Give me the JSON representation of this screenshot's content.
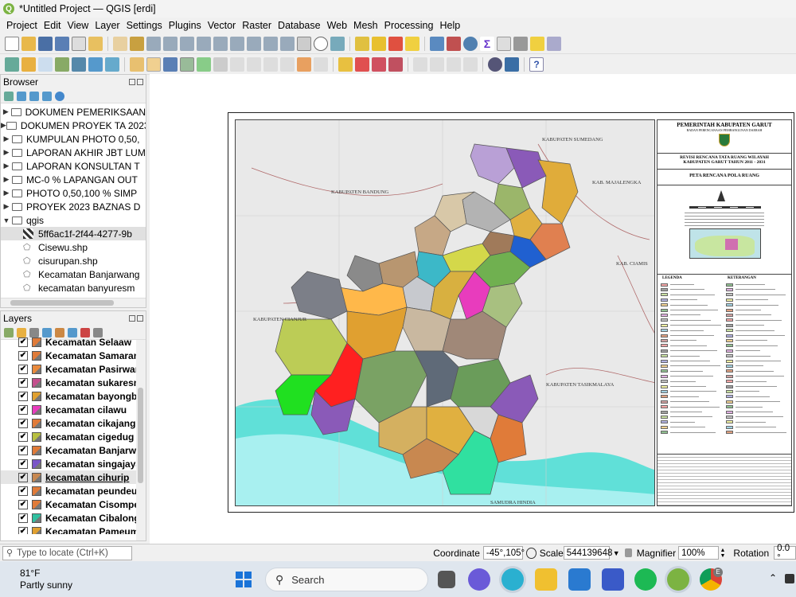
{
  "window": {
    "title": "*Untitled Project — QGIS [erdi]"
  },
  "menu": [
    "Project",
    "Edit",
    "View",
    "Layer",
    "Settings",
    "Plugins",
    "Vector",
    "Raster",
    "Database",
    "Web",
    "Mesh",
    "Processing",
    "Help"
  ],
  "browser": {
    "title": "Browser",
    "items": [
      {
        "label": "DOKUMEN PEMERIKSAAN",
        "type": "folder"
      },
      {
        "label": "DOKUMEN PROYEK TA 2023",
        "type": "folder"
      },
      {
        "label": "KUMPULAN PHOTO 0,50,",
        "type": "folder"
      },
      {
        "label": "LAPORAN AKHIR JBT LUM",
        "type": "folder"
      },
      {
        "label": "LAPORAN KONSULTAN T",
        "type": "folder"
      },
      {
        "label": "MC-0 % LAPANGAN OUT",
        "type": "folder"
      },
      {
        "label": "PHOTO 0,50,100 % SIMP",
        "type": "folder"
      },
      {
        "label": "PROYEK 2023 BAZNAS D",
        "type": "folder"
      },
      {
        "label": "qgis",
        "type": "folder-open"
      },
      {
        "label": "5ff6ac1f-2f44-4277-9b",
        "type": "raster"
      },
      {
        "label": "Cisewu.shp",
        "type": "shp"
      },
      {
        "label": "cisurupan.shp",
        "type": "shp"
      },
      {
        "label": "Kecamatan Banjarwang",
        "type": "shp"
      },
      {
        "label": "kecamatan banyuresm",
        "type": "shp"
      }
    ]
  },
  "layers": {
    "title": "Layers",
    "items": [
      {
        "label": "Kecamatan Selaaw",
        "color": "#e07b39",
        "underline": false
      },
      {
        "label": "Kecamatan Samarang",
        "color": "#e07b39",
        "underline": false
      },
      {
        "label": "Kecamatan Pasirwang",
        "color": "#e98a3c",
        "underline": false
      },
      {
        "label": "kecamatan sukaresmi",
        "color": "#c44f8d",
        "underline": false
      },
      {
        "label": "kecamatan bayongbo",
        "color": "#e0a030",
        "underline": false
      },
      {
        "label": "kecamatan cilawu",
        "color": "#e83cbd",
        "underline": false
      },
      {
        "label": "kecamatan cikajang",
        "color": "#e07b39",
        "underline": false
      },
      {
        "label": "kecamatan cigedug",
        "color": "#b8c040",
        "underline": false
      },
      {
        "label": "Kecamatan Banjarwa",
        "color": "#e07b39",
        "underline": false
      },
      {
        "label": "kecamatan singajaya",
        "color": "#7a55c8",
        "underline": false
      },
      {
        "label": "kecamatan cihurip",
        "color": "#c88850",
        "underline": true
      },
      {
        "label": "kecamatan peundeuy",
        "color": "#e07b39",
        "underline": false
      },
      {
        "label": "Kecamatan Cisompet",
        "color": "#e07b39",
        "underline": false
      },
      {
        "label": "Kecamatan Cibalong",
        "color": "#30c0a0",
        "underline": false
      },
      {
        "label": "Kecamatan Pameump",
        "color": "#e0a030",
        "underline": false
      }
    ]
  },
  "map": {
    "labels": [
      {
        "text": "KABUPATEN SUMEDANG"
      },
      {
        "text": "KABUPATEN BANDUNG"
      },
      {
        "text": "KAB. MAJALENGKA"
      },
      {
        "text": "KAB. CIAMIS"
      },
      {
        "text": "KABUPATEN CIANJUR"
      },
      {
        "text": "KABUPATEN TASIKMALAYA"
      },
      {
        "text": "SAMUDRA HINDIA"
      }
    ],
    "sheet": {
      "org1": "PEMERINTAH KABUPATEN GARUT",
      "org2": "BADAN PERENCANAAN PEMBANGUNAN DAERAH",
      "rev1": "REVISI RENCANA TATA RUANG WILAYAH",
      "rev2": "KABUPATEN GARUT TAHUN 2011 - 2031",
      "peta": "PETA RENCANA POLA RUANG",
      "legenda": "LEGENDA",
      "keterangan": "KETERANGAN"
    }
  },
  "statusbar": {
    "locate_placeholder": "Type to locate (Ctrl+K)",
    "coordinate_label": "Coordinate",
    "coordinate_value": "-45°,105°",
    "scale_label": "Scale",
    "scale_value": "544139648",
    "magnifier_label": "Magnifier",
    "magnifier_value": "100%",
    "rotation_label": "Rotation",
    "rotation_value": "0.0 °"
  },
  "taskbar": {
    "weather_temp": "81°F",
    "weather_desc": "Partly sunny",
    "search_label": "Search",
    "badge": "E"
  }
}
